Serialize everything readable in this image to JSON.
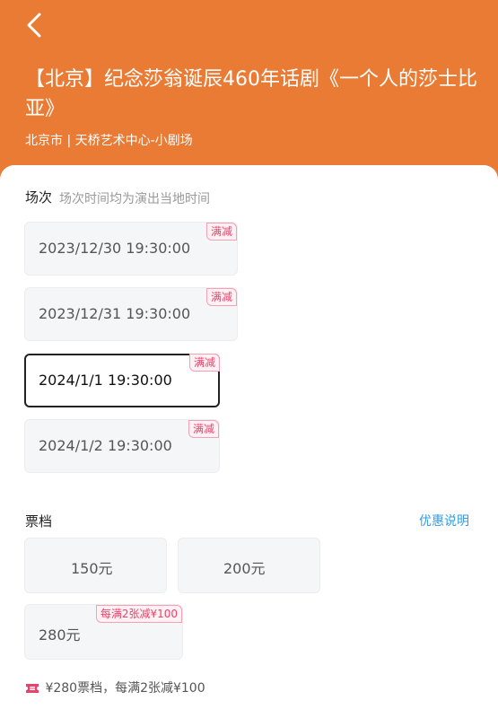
{
  "header": {
    "title": "【北京】纪念莎翁诞辰460年话剧《一个人的莎士比亚》",
    "venue": "北京市 | 天桥艺术中心-小剧场",
    "bg_color": "#E97B34"
  },
  "sessions_section": {
    "label": "场次",
    "note": "场次时间均为演出当地时间",
    "items": [
      {
        "time": "2023/12/30 19:30:00",
        "badge": "满减",
        "selected": false
      },
      {
        "time": "2023/12/31 19:30:00",
        "badge": "满减",
        "selected": false
      },
      {
        "time": "2024/1/1 19:30:00",
        "badge": "满减",
        "selected": true
      },
      {
        "time": "2024/1/2 19:30:00",
        "badge": "满减",
        "selected": false
      }
    ]
  },
  "prices_section": {
    "label": "票档",
    "link": "优惠说明",
    "items": [
      {
        "label": "150元",
        "badge": ""
      },
      {
        "label": "200元",
        "badge": ""
      },
      {
        "label": "280元",
        "badge": "每满2张减¥100"
      }
    ]
  },
  "promo": {
    "icon": "ticket-icon",
    "text": "¥280票档，每满2张减¥100"
  },
  "colors": {
    "accent": "#E97B34",
    "badge_text": "#E8436B",
    "link": "#3A9BE0"
  }
}
